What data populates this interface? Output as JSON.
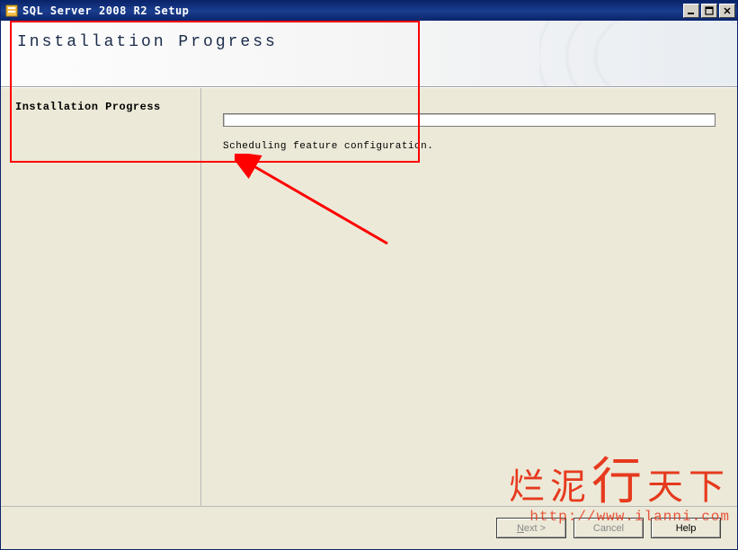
{
  "window": {
    "title": "SQL Server 2008 R2 Setup"
  },
  "header": {
    "title": "Installation Progress"
  },
  "sidebar": {
    "current_step": "Installation Progress"
  },
  "main": {
    "status_text": "Scheduling feature configuration.",
    "progress_percent": 0
  },
  "footer": {
    "next_label": "Next >",
    "cancel_label": "Cancel",
    "help_label": "Help"
  },
  "watermark": {
    "line1_a": "烂泥",
    "line1_b": "行",
    "line1_c": "天下",
    "line2": "http://www.ilanni.com"
  },
  "annotations": {
    "red_box_note": "highlight over header and sidebar step",
    "arrow_note": "red arrow pointing to highlighted region"
  }
}
